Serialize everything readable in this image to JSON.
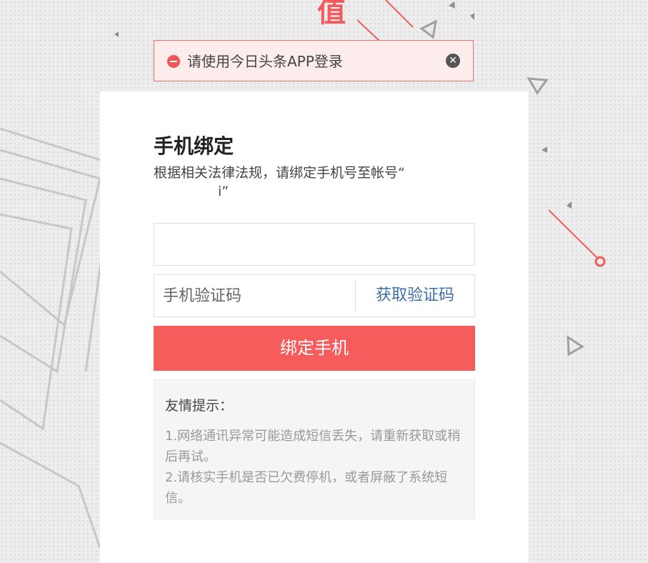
{
  "alert": {
    "message": "请使用今日头条APP登录",
    "close_glyph": "✕",
    "icon": "minus-circle-icon",
    "color": "#f05656"
  },
  "background": {
    "partial_headline": "值",
    "accent_color": "#f25b5b"
  },
  "form": {
    "title": "手机绑定",
    "subtitle_text": "根据相关法律法规，请绑定手机号至帐号“",
    "subtitle_fragment": "i”",
    "phone": {
      "value": "",
      "placeholder": ""
    },
    "code": {
      "value": "",
      "placeholder": "手机验证码"
    },
    "get_code_label": "获取验证码",
    "submit_label": "绑定手机",
    "submit_color": "#f75c5c",
    "link_color": "#3d6fa8"
  },
  "tips": {
    "title": "友情提示：",
    "lines": [
      "1.网络通讯异常可能造成短信丢失，请重新获取或稍后再试。",
      "2.请核实手机是否已欠费停机，或者屏蔽了系统短信。"
    ]
  }
}
